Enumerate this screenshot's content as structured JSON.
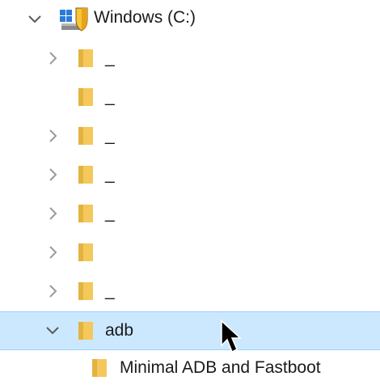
{
  "tree": {
    "drive": {
      "label": "Windows (C:)",
      "icon": "drive-shield-icon",
      "expanded": true
    },
    "folders": [
      {
        "label": "_",
        "has_children": true
      },
      {
        "label": "_",
        "has_children": false
      },
      {
        "label": "_",
        "has_children": true
      },
      {
        "label": "_",
        "has_children": true
      },
      {
        "label": "_",
        "has_children": true
      },
      {
        "label": "",
        "has_children": true
      },
      {
        "label": "_",
        "has_children": true
      },
      {
        "label": "adb",
        "has_children": true,
        "expanded": true,
        "selected": true
      },
      {
        "label": "Minimal ADB and Fastboot",
        "has_children": false
      }
    ]
  },
  "colors": {
    "selection_bg": "#cce8ff",
    "selection_border": "#99d1ff",
    "folder": "#f4c85a",
    "chevron": "#9a9a9a"
  },
  "pointer": {
    "icon": "mouse-pointer-icon"
  }
}
